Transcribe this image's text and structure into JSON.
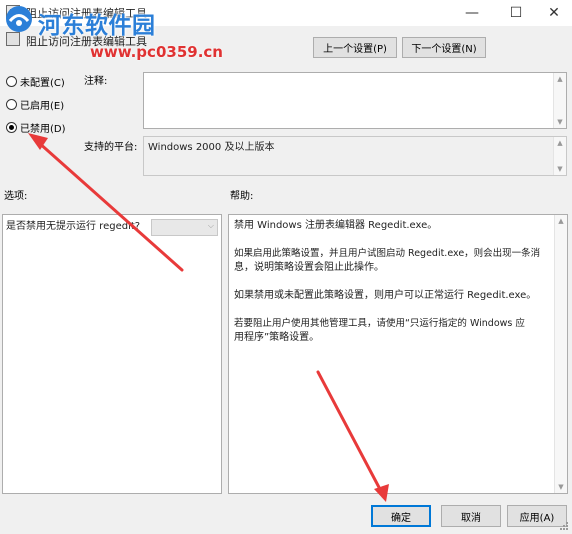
{
  "window": {
    "title": "阻止访问注册表编辑工具",
    "minimize_glyph": "—",
    "maximize_glyph": "☐",
    "close_glyph": "✕"
  },
  "header": {
    "policy_title": "阻止访问注册表编辑工具",
    "prev_setting_label": "上一个设置(P)",
    "next_setting_label": "下一个设置(N)"
  },
  "watermark": {
    "site_name": "河东软件园",
    "site_url": "www.pc0359.cn"
  },
  "state": {
    "options": [
      {
        "label": "未配置(C)",
        "checked": false
      },
      {
        "label": "已启用(E)",
        "checked": false
      },
      {
        "label": "已禁用(D)",
        "checked": true
      }
    ]
  },
  "comment": {
    "label": "注释:",
    "value": ""
  },
  "platform": {
    "label": "支持的平台:",
    "value": "Windows 2000 及以上版本"
  },
  "options_pane": {
    "heading": "选项:",
    "item_label": "是否禁用无提示运行 regedit?",
    "dropdown_value": ""
  },
  "help_pane": {
    "heading": "帮助:",
    "paragraphs": {
      "p1": "禁用 Windows 注册表编辑器 Regedit.exe。",
      "p2a": "如果启用此策略设置，并且用户试图启动 Regedit.exe，则会出现一条消",
      "p2b": "息，说明策略设置会阻止此操作。",
      "p3": "如果禁用或未配置此策略设置，则用户可以正常运行 Regedit.exe。",
      "p4a": "若要阻止用户使用其他管理工具，请使用“只运行指定的 Windows 应",
      "p4b": "用程序”策略设置。"
    }
  },
  "footer": {
    "ok_label": "确定",
    "cancel_label": "取消",
    "apply_label": "应用(A)"
  },
  "icons": {
    "window_icon": "group-policy-icon",
    "annotation_arrows": "red-arrow-icon"
  },
  "colors": {
    "accent": "#0078d7",
    "annotation": "#e83a3a",
    "watermark_blue": "#2b7fd8",
    "watermark_red": "#e03232"
  }
}
